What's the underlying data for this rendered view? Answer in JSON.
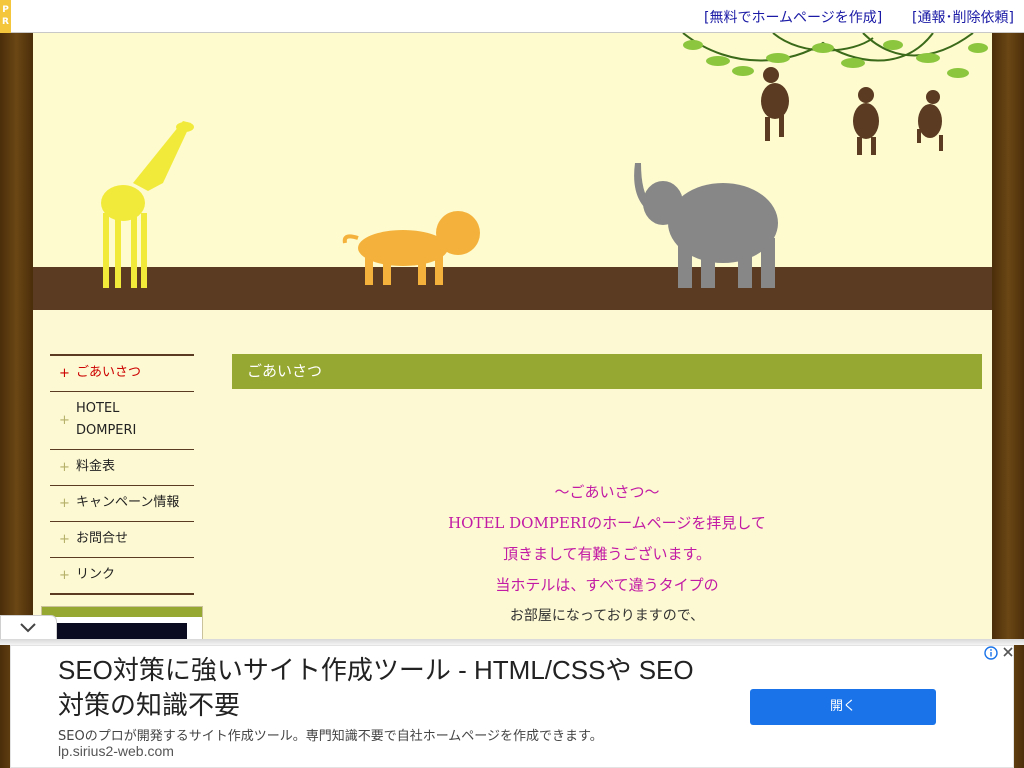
{
  "topbar": {
    "pr_label": "PR",
    "create_link": "[無料でホームページを作成]",
    "report_link": "[通報･削除依頼]"
  },
  "sidebar": {
    "items": [
      {
        "label": "ごあいさつ",
        "active": true
      },
      {
        "label": "HOTEL DOMPERI",
        "active": false
      },
      {
        "label": "料金表",
        "active": false
      },
      {
        "label": "キャンペーン情報",
        "active": false
      },
      {
        "label": "お問合せ",
        "active": false
      },
      {
        "label": "リンク",
        "active": false
      }
    ],
    "plus_glyph": "+"
  },
  "main": {
    "title": "ごあいさつ",
    "lines": [
      "～ごあいさつ～",
      "HOTEL DOMPERIのホームページを拝見して",
      "頂きまして有難うございます。",
      "当ホテルは、すべて違うタイプの",
      "お部屋になっておりますので、"
    ]
  },
  "ad": {
    "title": "SEO対策に強いサイト作成ツール - HTML/CSSや SEO対策の知識不要",
    "description": "SEOのプロが開発するサイト作成ツール。専門知識不要で自社ホームページを作成できます。",
    "url": "lp.sirius2-web.com",
    "button_label": "開く",
    "info_icon": "info-icon",
    "close_icon": "close-icon",
    "collapse_icon": "chevron-down-icon"
  },
  "colors": {
    "accent_green": "#97a832",
    "ground_brown": "#5b3b22",
    "text_magenta": "#c21aa5",
    "link_blue": "#1a1aa6",
    "ad_button": "#1a73e8"
  }
}
